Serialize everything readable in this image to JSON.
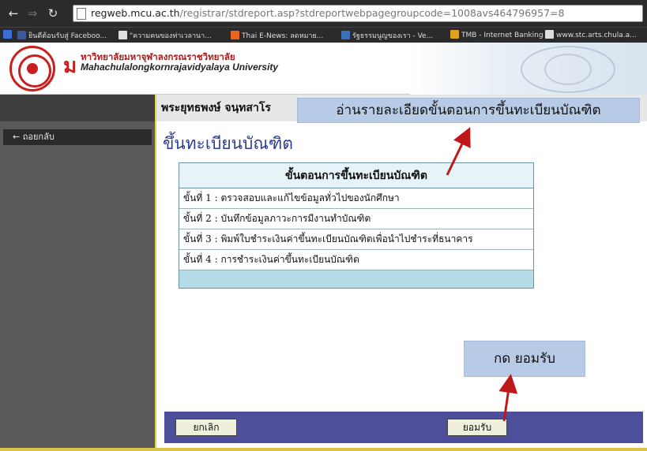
{
  "browser": {
    "url_host": "regweb.mcu.ac.th",
    "url_path": "/registrar/stdreport.asp?stdreportwebpagegroupcode=1008avs464796957=8",
    "bookmarks": [
      "ยินดีต้อนรับสู่ Faceboo...",
      "\"ความคนของท่าเวลานา...",
      "Thai E-News: ลดหมาย...",
      "รัฐธรรมนูญของเรา - Ve...",
      "TMB - Internet Banking",
      "www.stc.arts.chula.a..."
    ],
    "bookmark_colors": [
      "#3b5998",
      "#dddddd",
      "#e8641c",
      "#3b6fb6",
      "#e0a020",
      "#dddddd"
    ]
  },
  "banner": {
    "logo_mark": "ม",
    "university_th": "หาวิทยาลัยมหาจุฬาลงกรณราชวิทยาลัย",
    "university_en": "Mahachulalongkornrajavidyalaya University"
  },
  "sidebar": {
    "back_label": "← ถอยกลับ"
  },
  "main": {
    "user_name": "พระยุทธพงษ์ จนฺทสาโร",
    "heading": "ขึ้นทะเบียนบัณฑิต",
    "steps_title": "ขั้นตอนการขึ้นทะเบียนบัณฑิต",
    "steps": [
      "ขั้นที่ 1 : ตรวจสอบและแก้ไขข้อมูลทั่วไปของนักศึกษา",
      "ขั้นที่ 2 : บันทึกข้อมูลภาวะการมีงานทำบัณฑิต",
      "ขั้นที่ 3 : พิมพ์ใบชำระเงินค่าขึ้นทะเบียนบัณฑิตเพื่อนำไปชำระที่ธนาคาร",
      "ขั้นที่ 4 : การชำระเงินค่าขึ้นทะเบียนบัณฑิต"
    ],
    "cancel_label": "ยกเลิก",
    "accept_label": "ยอมรับ"
  },
  "annotations": {
    "top_text": "อ่านรายละเอียดขั้นตอนการขึ้นทะเบียนบัณฑิต",
    "bottom_text": "กด ยอมรับ",
    "arrow_color": "#c0181a"
  }
}
